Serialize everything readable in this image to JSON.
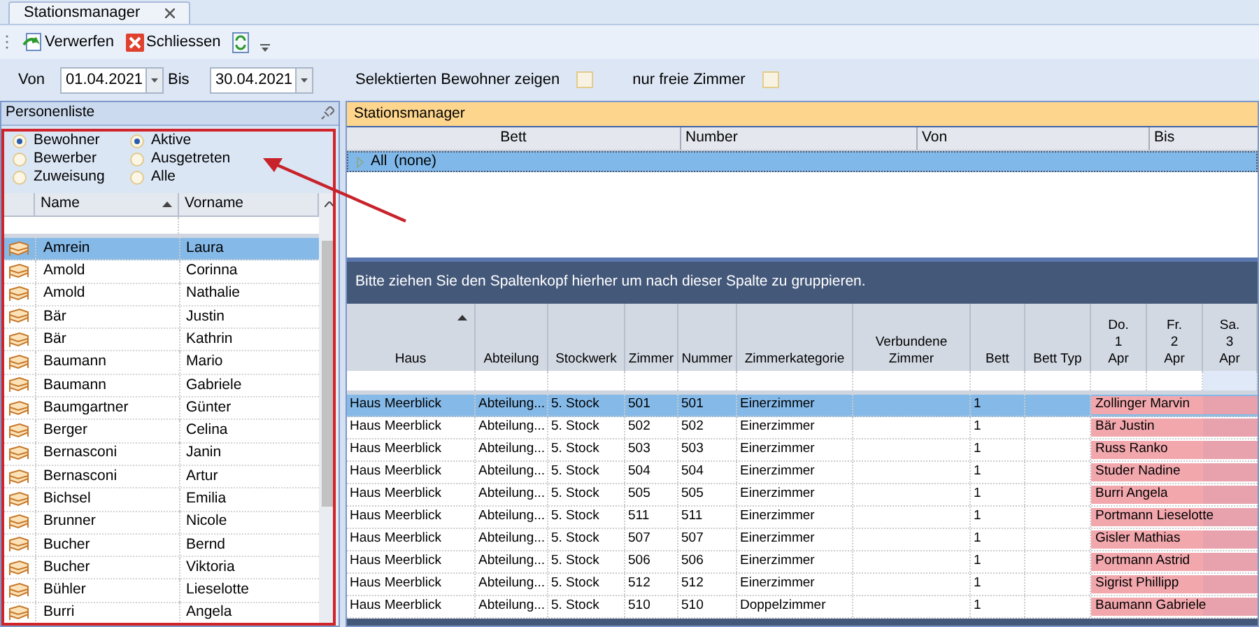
{
  "tab": {
    "label": "Stationsmanager"
  },
  "toolbar": [
    {
      "kind": "discard",
      "label": "Verwerfen"
    },
    {
      "kind": "close",
      "label": "Schliessen"
    },
    {
      "kind": "refresh"
    }
  ],
  "filters": {
    "von_label": "Von",
    "von_value": "01.04.2021",
    "bis_label": "Bis",
    "bis_value": "30.04.2021",
    "checkboxes": [
      {
        "label": "Selektierten Bewohner zeigen",
        "checked": false
      },
      {
        "label": "nur freie Zimmer",
        "checked": false
      }
    ]
  },
  "person_list": {
    "title": "Personenliste",
    "type_options": [
      {
        "label": "Bewohner",
        "selected": true
      },
      {
        "label": "Bewerber",
        "selected": false
      },
      {
        "label": "Zuweisung",
        "selected": false
      }
    ],
    "status_options": [
      {
        "label": "Aktive",
        "selected": true
      },
      {
        "label": "Ausgetreten",
        "selected": false
      },
      {
        "label": "Alle",
        "selected": false
      }
    ],
    "columns": [
      "Name",
      "Vorname"
    ],
    "rows": [
      {
        "name": "Amrein",
        "vorname": "Laura",
        "selected": true
      },
      {
        "name": "Amold",
        "vorname": "Corinna",
        "selected": false
      },
      {
        "name": "Amold",
        "vorname": "Nathalie",
        "selected": false
      },
      {
        "name": "Bär",
        "vorname": "Justin",
        "selected": false
      },
      {
        "name": "Bär",
        "vorname": "Kathrin",
        "selected": false
      },
      {
        "name": "Baumann",
        "vorname": "Mario",
        "selected": false
      },
      {
        "name": "Baumann",
        "vorname": "Gabriele",
        "selected": false
      },
      {
        "name": "Baumgartner",
        "vorname": "Günter",
        "selected": false
      },
      {
        "name": "Berger",
        "vorname": "Celina",
        "selected": false
      },
      {
        "name": "Bernasconi",
        "vorname": "Janin",
        "selected": false
      },
      {
        "name": "Bernasconi",
        "vorname": "Artur",
        "selected": false
      },
      {
        "name": "Bichsel",
        "vorname": "Emilia",
        "selected": false
      },
      {
        "name": "Brunner",
        "vorname": "Nicole",
        "selected": false
      },
      {
        "name": "Bucher",
        "vorname": "Bernd",
        "selected": false
      },
      {
        "name": "Bucher",
        "vorname": "Viktoria",
        "selected": false
      },
      {
        "name": "Bühler",
        "vorname": "Lieselotte",
        "selected": false
      },
      {
        "name": "Burri",
        "vorname": "Angela",
        "selected": false
      }
    ]
  },
  "station": {
    "title": "Stationsmanager",
    "group_columns": [
      "Bett",
      "Number",
      "Von",
      "Bis"
    ],
    "group_row": {
      "label": "All",
      "value": "(none)",
      "selected": true
    },
    "group_hint": "Bitte ziehen Sie den Spaltenkopf hierher um nach dieser Spalte zu gruppieren.",
    "columns": [
      "Haus",
      "Abteilung",
      "Stockwerk",
      "Zimmer",
      "Nummer",
      "Zimmerkategorie",
      "Verbundene\nZimmer",
      "Bett",
      "Bett Typ",
      "Do.\n1\nApr",
      "Fr.\n2\nApr",
      "Sa.\n3\nApr"
    ],
    "rows": [
      {
        "cells": [
          "Haus Meerblick",
          "Abteilung...",
          "5. Stock",
          "501",
          "501",
          "Einerzimmer",
          "",
          "1",
          ""
        ],
        "occupant": "Zollinger Marvin",
        "selected": true
      },
      {
        "cells": [
          "Haus Meerblick",
          "Abteilung...",
          "5. Stock",
          "502",
          "502",
          "Einerzimmer",
          "",
          "1",
          ""
        ],
        "occupant": "Bär Justin",
        "selected": false
      },
      {
        "cells": [
          "Haus Meerblick",
          "Abteilung...",
          "5. Stock",
          "503",
          "503",
          "Einerzimmer",
          "",
          "1",
          ""
        ],
        "occupant": "Russ Ranko",
        "selected": false
      },
      {
        "cells": [
          "Haus Meerblick",
          "Abteilung...",
          "5. Stock",
          "504",
          "504",
          "Einerzimmer",
          "",
          "1",
          ""
        ],
        "occupant": "Studer Nadine",
        "selected": false
      },
      {
        "cells": [
          "Haus Meerblick",
          "Abteilung...",
          "5. Stock",
          "505",
          "505",
          "Einerzimmer",
          "",
          "1",
          ""
        ],
        "occupant": "Burri Angela",
        "selected": false
      },
      {
        "cells": [
          "Haus Meerblick",
          "Abteilung...",
          "5. Stock",
          "511",
          "511",
          "Einerzimmer",
          "",
          "1",
          ""
        ],
        "occupant": "Portmann Lieselotte",
        "selected": false
      },
      {
        "cells": [
          "Haus Meerblick",
          "Abteilung...",
          "5. Stock",
          "507",
          "507",
          "Einerzimmer",
          "",
          "1",
          ""
        ],
        "occupant": "Gisler Mathias",
        "selected": false
      },
      {
        "cells": [
          "Haus Meerblick",
          "Abteilung...",
          "5. Stock",
          "506",
          "506",
          "Einerzimmer",
          "",
          "1",
          ""
        ],
        "occupant": "Portmann Astrid",
        "selected": false
      },
      {
        "cells": [
          "Haus Meerblick",
          "Abteilung...",
          "5. Stock",
          "512",
          "512",
          "Einerzimmer",
          "",
          "1",
          ""
        ],
        "occupant": "Sigrist Phillipp",
        "selected": false
      },
      {
        "cells": [
          "Haus Meerblick",
          "Abteilung...",
          "5. Stock",
          "510",
          "510",
          "Doppelzimmer",
          "",
          "1",
          ""
        ],
        "occupant": "Baumann Gabriele",
        "selected": false
      }
    ]
  }
}
